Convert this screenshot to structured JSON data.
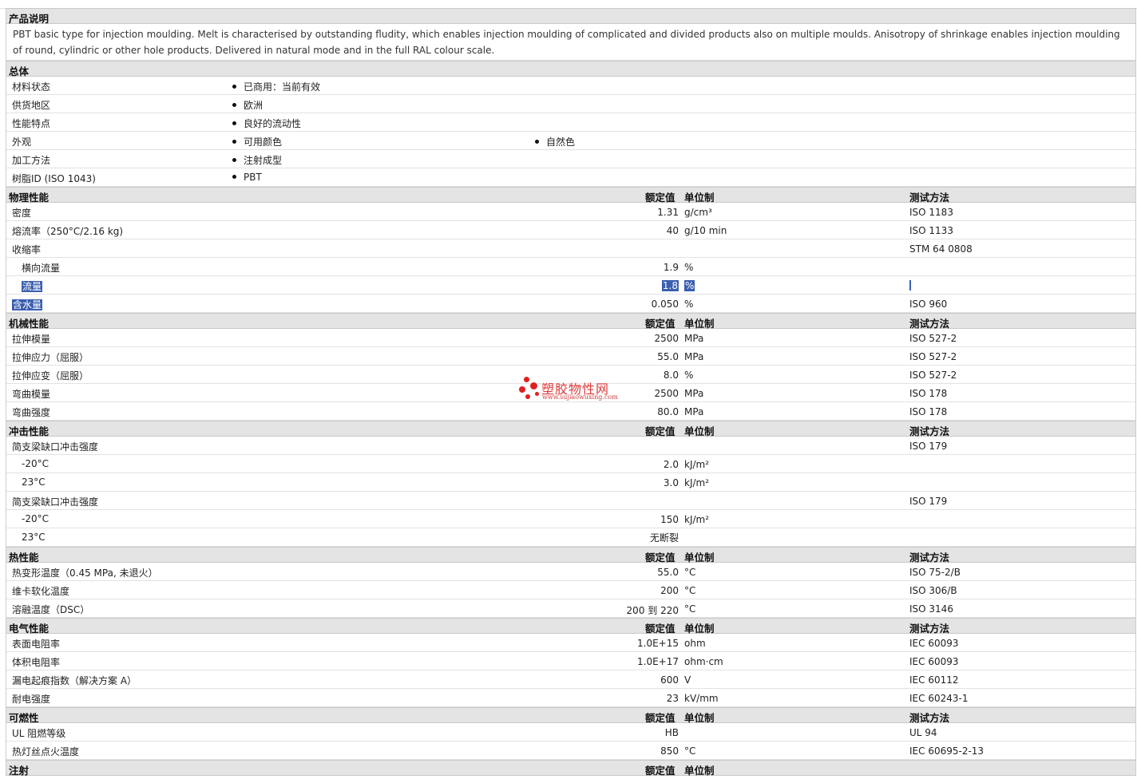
{
  "sections": {
    "desc": {
      "title": "产品说明",
      "text": "PBT basic type for injection moulding. Melt is characterised by outstanding fludity, which enables injection moulding of complicated and divided products also on multiple moulds. Anisotropy of shrinkage enables injection moulding of round, cylindric or other hole products. Delivered in natural mode and in the full RAL colour scale."
    },
    "general": {
      "title": "总体",
      "rows": [
        {
          "label": "材料状态",
          "b1": "已商用：当前有效"
        },
        {
          "label": "供货地区",
          "b1": "欧洲"
        },
        {
          "label": "性能特点",
          "b1": "良好的流动性"
        },
        {
          "label": "外观",
          "b1": "可用颜色",
          "b2": "自然色"
        },
        {
          "label": "加工方法",
          "b1": "注射成型"
        },
        {
          "label": "树脂ID (ISO 1043)",
          "b1": "PBT"
        }
      ]
    },
    "physical": {
      "title": "物理性能",
      "col_value": "额定值",
      "col_unit": "单位制",
      "col_method": "测试方法",
      "rows": [
        {
          "label": "密度",
          "value": "1.31",
          "unit": "g/cm³",
          "method": "ISO 1183"
        },
        {
          "label": "熔流率（250°C/2.16 kg)",
          "value": "40",
          "unit": "g/10 min",
          "method": "ISO 1133"
        },
        {
          "label": "收缩率",
          "value": "",
          "unit": "",
          "method": "STM 64 0808"
        },
        {
          "label": "横向流量",
          "value": "1.9",
          "unit": "%",
          "method": ""
        },
        {
          "label": "流量",
          "value": "1.8",
          "unit": "%",
          "method": ""
        },
        {
          "label": "含水量",
          "value": "0.050",
          "unit": "%",
          "method": "ISO 960"
        }
      ]
    },
    "mechanical": {
      "title": "机械性能",
      "col_value": "额定值",
      "col_unit": "单位制",
      "col_method": "测试方法",
      "rows": [
        {
          "label": "拉伸模量",
          "value": "2500",
          "unit": "MPa",
          "method": "ISO 527-2"
        },
        {
          "label": "拉伸应力（屈服）",
          "value": "55.0",
          "unit": "MPa",
          "method": "ISO 527-2"
        },
        {
          "label": "拉伸应变（屈服）",
          "value": "8.0",
          "unit": "%",
          "method": "ISO 527-2"
        },
        {
          "label": "弯曲模量",
          "value": "2500",
          "unit": "MPa",
          "method": "ISO 178"
        },
        {
          "label": "弯曲强度",
          "value": "80.0",
          "unit": "MPa",
          "method": "ISO 178"
        }
      ]
    },
    "impact": {
      "title": "冲击性能",
      "col_value": "额定值",
      "col_unit": "单位制",
      "col_method": "测试方法",
      "rows": [
        {
          "label": "简支梁缺口冲击强度",
          "value": "",
          "unit": "",
          "method": "ISO 179"
        },
        {
          "label": "-20°C",
          "value": "2.0",
          "unit": "kJ/m²",
          "method": ""
        },
        {
          "label": "23°C",
          "value": "3.0",
          "unit": "kJ/m²",
          "method": ""
        },
        {
          "label": "简支梁缺口冲击强度",
          "value": "",
          "unit": "",
          "method": "ISO 179"
        },
        {
          "label": "-20°C",
          "value": "150",
          "unit": "kJ/m²",
          "method": ""
        },
        {
          "label": "23°C",
          "value": "无断裂",
          "unit": "",
          "method": ""
        }
      ]
    },
    "thermal": {
      "title": "热性能",
      "col_value": "额定值",
      "col_unit": "单位制",
      "col_method": "测试方法",
      "rows": [
        {
          "label": "热变形温度（0.45 MPa, 未退火）",
          "value": "55.0",
          "unit": "°C",
          "method": "ISO 75-2/B"
        },
        {
          "label": "维卡软化温度",
          "value": "200",
          "unit": "°C",
          "method": "ISO 306/B"
        },
        {
          "label": "溶融温度（DSC）",
          "value": "200 到 220",
          "unit": "°C",
          "method": "ISO 3146"
        }
      ]
    },
    "electrical": {
      "title": "电气性能",
      "col_value": "额定值",
      "col_unit": "单位制",
      "col_method": "测试方法",
      "rows": [
        {
          "label": "表面电阻率",
          "value": "1.0E+15",
          "unit": "ohm",
          "method": "IEC 60093"
        },
        {
          "label": "体积电阻率",
          "value": "1.0E+17",
          "unit": "ohm·cm",
          "method": "IEC 60093"
        },
        {
          "label": "漏电起痕指数（解决方案 A）",
          "value": "600",
          "unit": "V",
          "method": "IEC 60112"
        },
        {
          "label": "耐电强度",
          "value": "23",
          "unit": "kV/mm",
          "method": "IEC 60243-1"
        }
      ]
    },
    "flammability": {
      "title": "可燃性",
      "col_value": "额定值",
      "col_unit": "单位制",
      "col_method": "测试方法",
      "rows": [
        {
          "label": "UL 阻燃等级",
          "value": "HB",
          "unit": "",
          "method": "UL 94"
        },
        {
          "label": "热灯丝点火温度",
          "value": "850",
          "unit": "°C",
          "method": "IEC 60695-2-13"
        }
      ]
    },
    "injection": {
      "title": "注射",
      "col_value": "额定值",
      "col_unit": "单位制"
    }
  },
  "watermark": {
    "name": "塑胶物性网",
    "url": "www.sujiaowuxing.com"
  }
}
